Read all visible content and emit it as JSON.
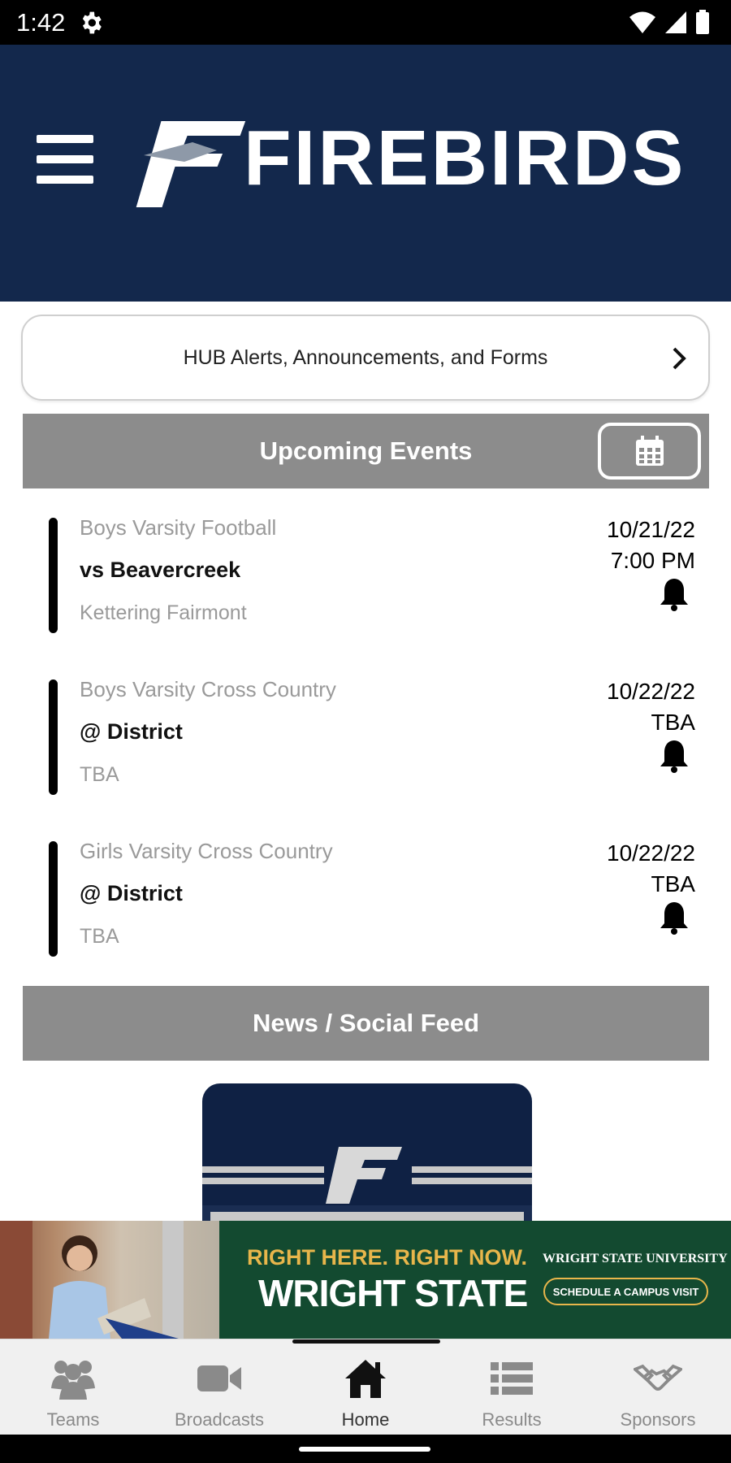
{
  "status_bar": {
    "time": "1:42"
  },
  "header": {
    "brand_name": "FIREBIRDS"
  },
  "alerts": {
    "label": "HUB Alerts, Announcements, and Forms"
  },
  "upcoming": {
    "title": "Upcoming Events",
    "events": [
      {
        "team": "Boys Varsity Football",
        "opponent": "vs Beavercreek",
        "location": "Kettering Fairmont",
        "date": "10/21/22",
        "time": "7:00 PM"
      },
      {
        "team": "Boys Varsity Cross Country",
        "opponent": "@ District",
        "location": "TBA",
        "date": "10/22/22",
        "time": "TBA"
      },
      {
        "team": "Girls Varsity Cross Country",
        "opponent": "@ District",
        "location": "TBA",
        "date": "10/22/22",
        "time": "TBA"
      }
    ]
  },
  "news": {
    "title": "News / Social Feed"
  },
  "ad": {
    "tagline": "RIGHT HERE. RIGHT NOW.",
    "title": "WRIGHT STATE",
    "university": "WRIGHT STATE UNIVERSITY",
    "cta": "SCHEDULE A CAMPUS VISIT"
  },
  "tabs": [
    {
      "label": "Teams",
      "icon": "teams-icon"
    },
    {
      "label": "Broadcasts",
      "icon": "video-camera-icon"
    },
    {
      "label": "Home",
      "icon": "home-icon"
    },
    {
      "label": "Results",
      "icon": "list-icon"
    },
    {
      "label": "Sponsors",
      "icon": "handshake-icon"
    }
  ],
  "active_tab": "Home",
  "colors": {
    "header_bg": "#13284c",
    "section_bar": "#8c8c8c",
    "ad_green": "#134a30",
    "ad_gold": "#e8b64b"
  }
}
